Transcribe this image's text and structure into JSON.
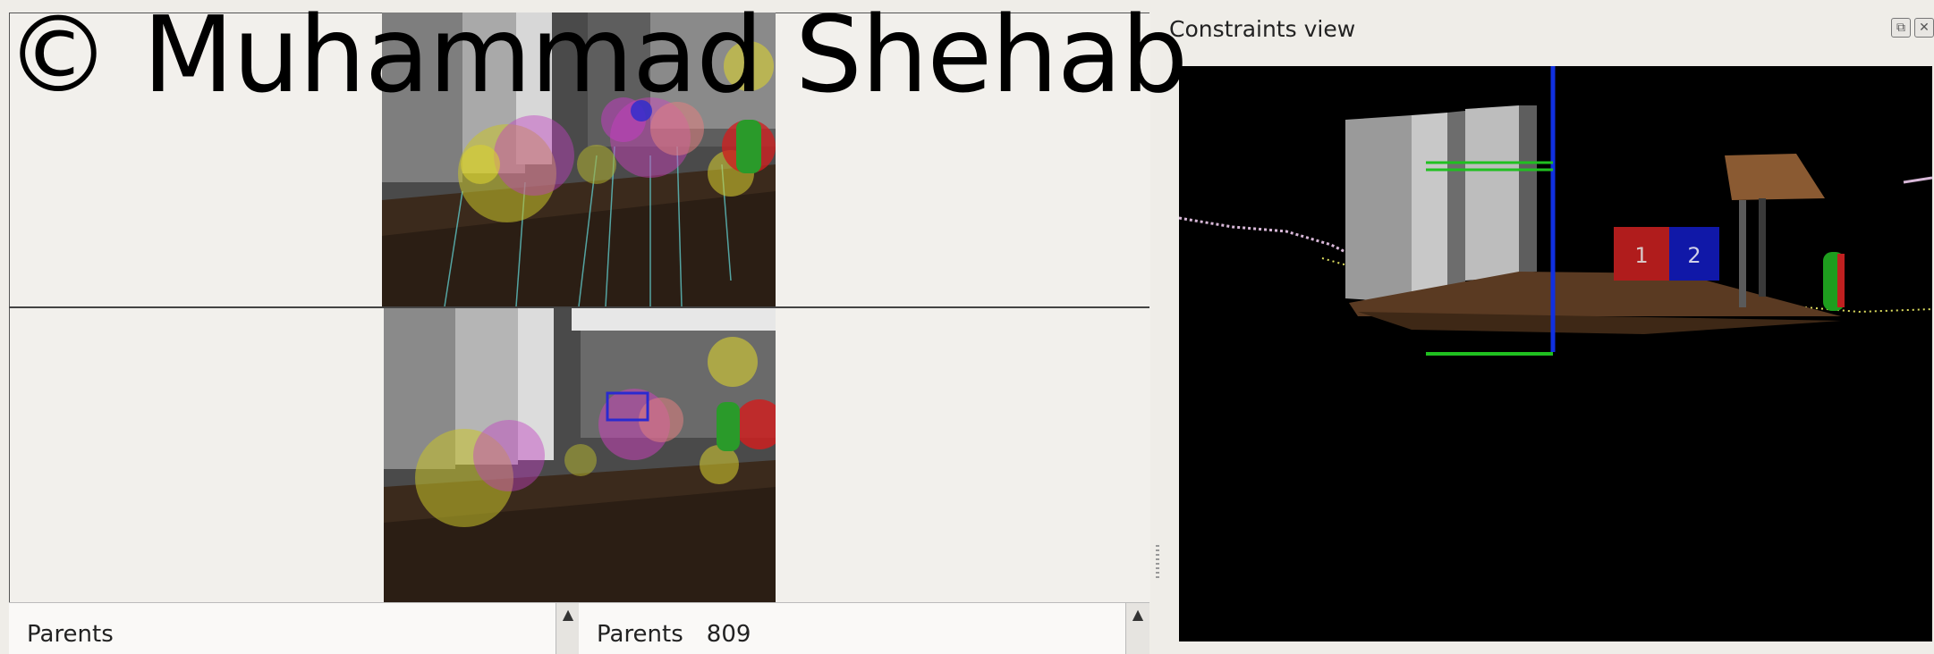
{
  "watermark": {
    "text": "© Muhammad Shehab"
  },
  "constraints_panel": {
    "title": "Constraints view",
    "float_button": "⧉",
    "close_button": "✕",
    "box_labels": [
      "1",
      "2"
    ]
  },
  "parents_lists": [
    {
      "label": "Parents",
      "count": ""
    },
    {
      "label": "Parents",
      "count": "809"
    }
  ],
  "scroll_up_glyph": "▲"
}
